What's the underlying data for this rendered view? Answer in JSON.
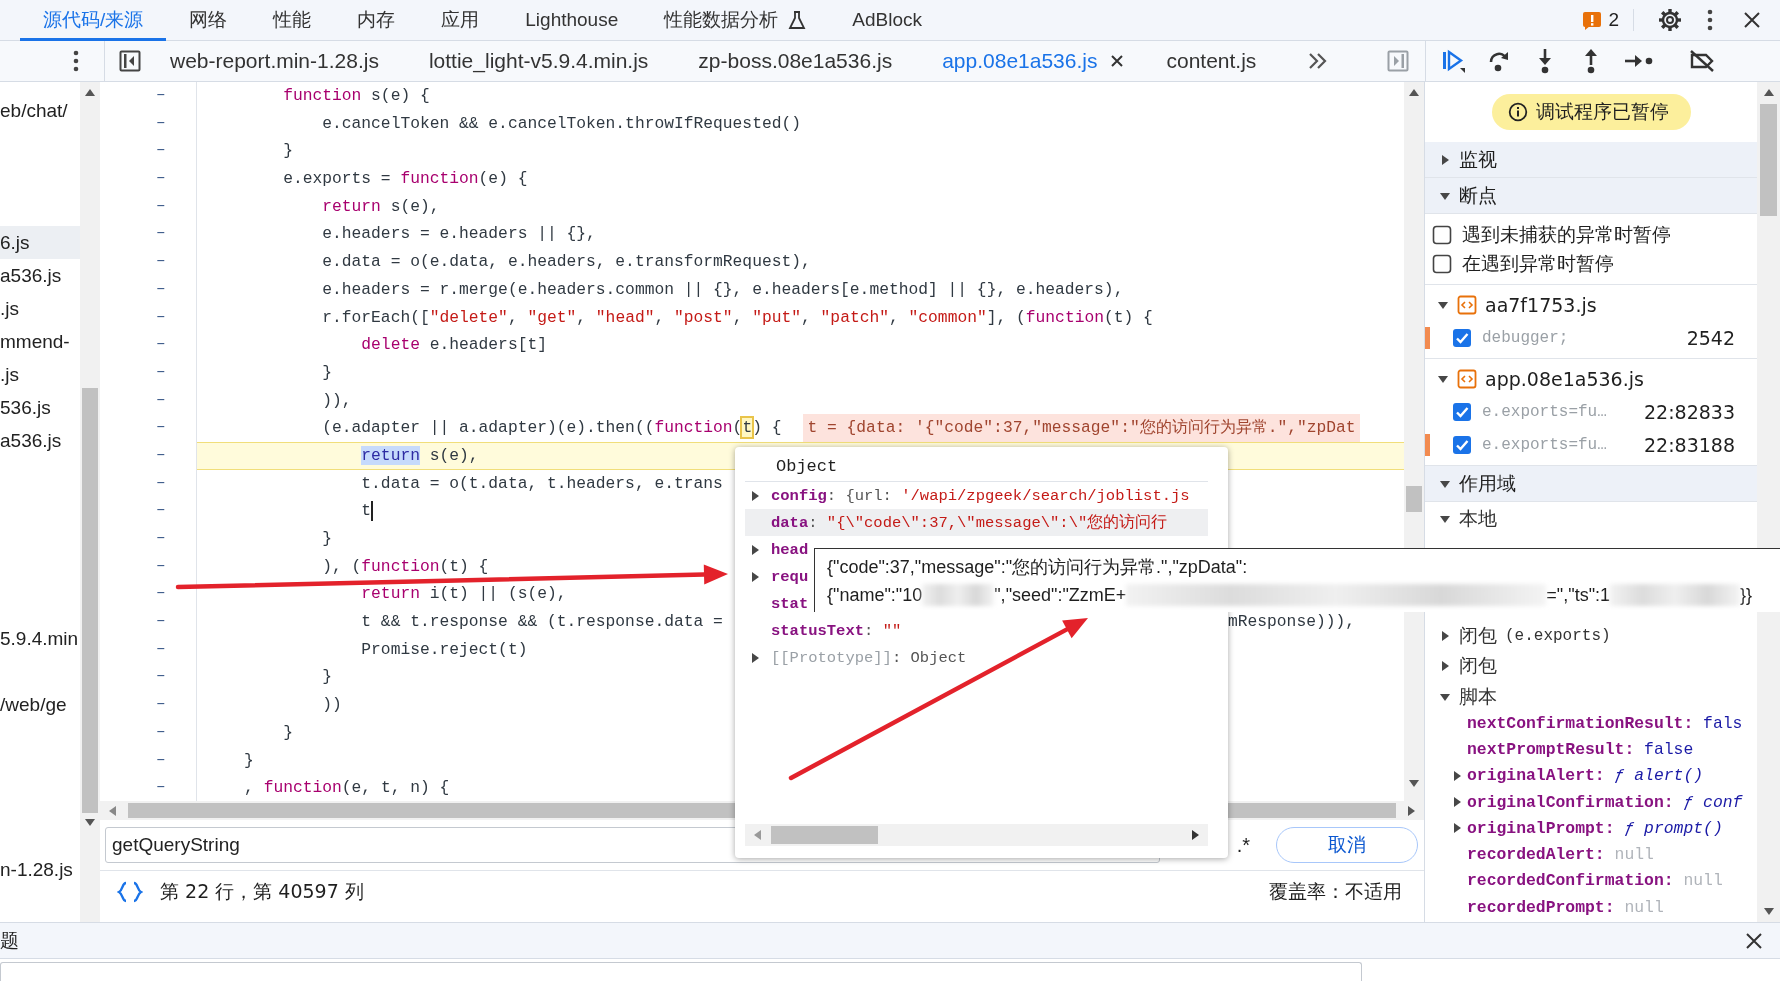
{
  "devtools_tabs": [
    {
      "label": "源代码/来源",
      "selected": true,
      "experimental": false
    },
    {
      "label": "网络",
      "selected": false,
      "experimental": false
    },
    {
      "label": "性能",
      "selected": false,
      "experimental": false
    },
    {
      "label": "内存",
      "selected": false,
      "experimental": false
    },
    {
      "label": "应用",
      "selected": false,
      "experimental": false
    },
    {
      "label": "Lighthouse",
      "selected": false,
      "experimental": false
    },
    {
      "label": "性能数据分析",
      "selected": false,
      "experimental": true
    },
    {
      "label": "AdBlock",
      "selected": false,
      "experimental": false
    }
  ],
  "issues_badge": {
    "count": "2"
  },
  "file_tabs": [
    {
      "label": "web-report.min-1.28.js",
      "selected": false
    },
    {
      "label": "lottie_light-v5.9.4.min.js",
      "selected": false
    },
    {
      "label": "zp-boss.08e1a536.js",
      "selected": false
    },
    {
      "label": "app.08e1a536.js",
      "selected": true
    },
    {
      "label": "content.js",
      "selected": false
    }
  ],
  "navigator": {
    "items": [
      {
        "label": "eb/chat/",
        "selected": false
      },
      {
        "label": "6.js",
        "selected": true
      },
      {
        "label": "a536.js",
        "selected": false
      },
      {
        "label": ".js",
        "selected": false
      },
      {
        "label": "mmend-",
        "selected": false
      },
      {
        "label": ".js",
        "selected": false
      },
      {
        "label": "536.js",
        "selected": false
      },
      {
        "label": "a536.js",
        "selected": false
      },
      {
        "label": "5.9.4.min",
        "selected": false
      },
      {
        "label": "/web/ge",
        "selected": false
      },
      {
        "label": "n-1.28.js",
        "selected": false
      }
    ]
  },
  "editor": {
    "lines": [
      {
        "mark": "–",
        "paused": false,
        "caret": false,
        "tokens": [
          {
            "kind": "keyword",
            "text": "        function"
          },
          {
            "kind": "plain",
            "text": " s(e) {"
          }
        ]
      },
      {
        "mark": "–",
        "paused": false,
        "caret": false,
        "tokens": [
          {
            "kind": "plain",
            "text": "            e.cancelToken && e.cancelToken.throwIfRequested()"
          }
        ]
      },
      {
        "mark": "–",
        "paused": false,
        "caret": false,
        "tokens": [
          {
            "kind": "plain",
            "text": "        }"
          }
        ]
      },
      {
        "mark": "–",
        "paused": false,
        "caret": false,
        "tokens": [
          {
            "kind": "plain",
            "text": "        e.exports = "
          },
          {
            "kind": "keyword",
            "text": "function"
          },
          {
            "kind": "plain",
            "text": "(e) {"
          }
        ]
      },
      {
        "mark": "–",
        "paused": false,
        "caret": false,
        "tokens": [
          {
            "kind": "keyword",
            "text": "            return"
          },
          {
            "kind": "plain",
            "text": " s(e),"
          }
        ]
      },
      {
        "mark": "–",
        "paused": false,
        "caret": false,
        "tokens": [
          {
            "kind": "plain",
            "text": "            e.headers = e.headers || {},"
          }
        ]
      },
      {
        "mark": "–",
        "paused": false,
        "caret": false,
        "tokens": [
          {
            "kind": "plain",
            "text": "            e.data = o(e.data, e.headers, e.transformRequest),"
          }
        ]
      },
      {
        "mark": "–",
        "paused": false,
        "caret": false,
        "tokens": [
          {
            "kind": "plain",
            "text": "            e.headers = r.merge(e.headers.common || {}, e.headers[e.method] || {}, e.headers),"
          }
        ]
      },
      {
        "mark": "–",
        "paused": false,
        "caret": false,
        "tokens": [
          {
            "kind": "plain",
            "text": "            r.forEach(["
          },
          {
            "kind": "string",
            "text": "\"delete\""
          },
          {
            "kind": "plain",
            "text": ", "
          },
          {
            "kind": "string",
            "text": "\"get\""
          },
          {
            "kind": "plain",
            "text": ", "
          },
          {
            "kind": "string",
            "text": "\"head\""
          },
          {
            "kind": "plain",
            "text": ", "
          },
          {
            "kind": "string",
            "text": "\"post\""
          },
          {
            "kind": "plain",
            "text": ", "
          },
          {
            "kind": "string",
            "text": "\"put\""
          },
          {
            "kind": "plain",
            "text": ", "
          },
          {
            "kind": "string",
            "text": "\"patch\""
          },
          {
            "kind": "plain",
            "text": ", "
          },
          {
            "kind": "string",
            "text": "\"common\""
          },
          {
            "kind": "plain",
            "text": "], ("
          },
          {
            "kind": "keyword",
            "text": "function"
          },
          {
            "kind": "plain",
            "text": "(t) {"
          }
        ]
      },
      {
        "mark": "–",
        "paused": false,
        "caret": false,
        "tokens": [
          {
            "kind": "keyword",
            "text": "                delete"
          },
          {
            "kind": "plain",
            "text": " e.headers[t]"
          }
        ]
      },
      {
        "mark": "–",
        "paused": false,
        "caret": false,
        "tokens": [
          {
            "kind": "plain",
            "text": "            }"
          }
        ]
      },
      {
        "mark": "–",
        "paused": false,
        "caret": false,
        "tokens": [
          {
            "kind": "plain",
            "text": "            )),"
          }
        ]
      },
      {
        "mark": "–",
        "paused": false,
        "caret": false,
        "tokens": [
          {
            "kind": "plain",
            "text": "            (e.adapter || a.adapter)(e).then(("
          },
          {
            "kind": "keyword",
            "text": "function"
          },
          {
            "kind": "plain",
            "text": "("
          },
          {
            "kind": "boxed",
            "text": "t"
          },
          {
            "kind": "plain",
            "text": ") {"
          }
        ],
        "inline_value": "t = {data: '{\"code\":37,\"message\":\"您的访问行为异常.\",\"zpDat"
      },
      {
        "mark": "–",
        "paused": true,
        "caret": false,
        "tokens": [
          {
            "kind": "match",
            "text": "                return"
          },
          {
            "kind": "plain",
            "text": " s(e),"
          }
        ]
      },
      {
        "mark": "–",
        "paused": false,
        "caret": false,
        "tokens": [
          {
            "kind": "plain",
            "text": "                t.data = o(t.data, t.headers, e.trans"
          }
        ]
      },
      {
        "mark": "–",
        "paused": false,
        "caret": true,
        "tokens": [
          {
            "kind": "plain",
            "text": "                t"
          }
        ]
      },
      {
        "mark": "–",
        "paused": false,
        "caret": false,
        "tokens": [
          {
            "kind": "plain",
            "text": "            }"
          }
        ]
      },
      {
        "mark": "–",
        "paused": false,
        "caret": false,
        "tokens": [
          {
            "kind": "plain",
            "text": "            ), ("
          },
          {
            "kind": "keyword",
            "text": "function"
          },
          {
            "kind": "plain",
            "text": "(t) {"
          }
        ]
      },
      {
        "mark": "–",
        "paused": false,
        "caret": false,
        "tokens": [
          {
            "kind": "keyword",
            "text": "                return"
          },
          {
            "kind": "plain",
            "text": " i(t) || (s(e),"
          }
        ]
      },
      {
        "mark": "–",
        "paused": false,
        "caret": false,
        "tokens": [
          {
            "kind": "plain",
            "text": "                t && t.response && (t.response.data ="
          }
        ],
        "tail": "mResponse))),"
      },
      {
        "mark": "–",
        "paused": false,
        "caret": false,
        "tokens": [
          {
            "kind": "plain",
            "text": "                Promise.reject(t)"
          }
        ]
      },
      {
        "mark": "–",
        "paused": false,
        "caret": false,
        "tokens": [
          {
            "kind": "plain",
            "text": "            }"
          }
        ]
      },
      {
        "mark": "–",
        "paused": false,
        "caret": false,
        "tokens": [
          {
            "kind": "plain",
            "text": "            ))"
          }
        ]
      },
      {
        "mark": "–",
        "paused": false,
        "caret": false,
        "tokens": [
          {
            "kind": "plain",
            "text": "        }"
          }
        ]
      },
      {
        "mark": "–",
        "paused": false,
        "caret": false,
        "tokens": [
          {
            "kind": "plain",
            "text": "    }"
          }
        ]
      },
      {
        "mark": "–",
        "paused": false,
        "caret": false,
        "tokens": [
          {
            "kind": "plain",
            "text": "    , "
          },
          {
            "kind": "keyword",
            "text": "function"
          },
          {
            "kind": "plain",
            "text": "(e, t, n) {"
          }
        ]
      }
    ],
    "search": {
      "value": "getQueryString",
      "regex": ".*",
      "cancel": "取消"
    },
    "status": {
      "position": "第 22 行，第 40597 列",
      "coverage": "覆盖率：不适用"
    }
  },
  "object_popup": {
    "title": "Object",
    "rows": [
      {
        "key": "config",
        "kind": "property",
        "expandable": true,
        "highlighted": false,
        "value": [
          {
            "kind": "plain",
            "text": ": {url: "
          },
          {
            "kind": "string",
            "text": "'/wapi/zpgeek/search/joblist.js"
          }
        ]
      },
      {
        "key": "data",
        "kind": "property",
        "expandable": false,
        "highlighted": true,
        "value": [
          {
            "kind": "plain",
            "text": ": "
          },
          {
            "kind": "string",
            "text": "\"{\\\"code\\\":37,\\\"message\\\":\\\"您的访问行"
          }
        ]
      },
      {
        "key": "head",
        "kind": "property",
        "expandable": true,
        "highlighted": false
      },
      {
        "key": "requ",
        "kind": "property",
        "expandable": true,
        "highlighted": false
      },
      {
        "key": "stat",
        "kind": "property",
        "expandable": false,
        "highlighted": false
      },
      {
        "key": "statusText",
        "kind": "property",
        "expandable": false,
        "highlighted": false,
        "value": [
          {
            "kind": "plain",
            "text": ": "
          },
          {
            "kind": "string",
            "text": "\"\""
          }
        ]
      },
      {
        "key": "[[Prototype]]",
        "kind": "internal",
        "expandable": true,
        "highlighted": false,
        "value": [
          {
            "kind": "plain",
            "text": ": Object"
          }
        ]
      }
    ]
  },
  "value_tooltip": {
    "line_1": "{\"code\":37,\"message\":\"您的访问行为异常.\",\"zpData\":",
    "line_2": [
      {
        "kind": "text",
        "text": "{\"name\":\"10"
      },
      {
        "kind": "redacted"
      },
      {
        "kind": "text",
        "text": "\",\"seed\":\"ZzmE+"
      },
      {
        "kind": "redacted"
      },
      {
        "kind": "text",
        "text": "=\",\"ts\":1"
      },
      {
        "kind": "redacted"
      },
      {
        "kind": "text",
        "text": "}}"
      }
    ]
  },
  "debugger": {
    "paused_banner": "调试程序已暂停",
    "watch": {
      "title": "监视",
      "expanded": false
    },
    "breakpoints": {
      "title": "断点",
      "expanded": true,
      "options": [
        {
          "label": "遇到未捕获的异常时暂停",
          "checked": false
        },
        {
          "label": "在遇到异常时暂停",
          "checked": false
        }
      ],
      "files": [
        {
          "name": "aa7f1753.js",
          "expanded": true,
          "items": [
            {
              "code": "debugger;",
              "location": "2542",
              "checked": true,
              "hit": true
            }
          ]
        },
        {
          "name": "app.08e1a536.js",
          "expanded": true,
          "items": [
            {
              "code": "e.exports=fu…",
              "location": "22:82833",
              "checked": true,
              "hit": false
            },
            {
              "code": "e.exports=fu…",
              "location": "22:83188",
              "checked": true,
              "hit": true
            }
          ]
        }
      ]
    },
    "scope": {
      "title": "作用域",
      "expanded": true,
      "groups": [
        {
          "label": "本地",
          "expanded": true
        },
        {
          "label": "闭包",
          "detail": "(e.exports)",
          "expanded": false
        },
        {
          "label": "闭包",
          "expanded": false
        },
        {
          "label": "脚本",
          "expanded": true,
          "children": [
            {
              "name": "nextConfirmationResult:",
              "value": "fals",
              "kind": "boolean",
              "expandable": false
            },
            {
              "name": "nextPromptResult:",
              "value": "false",
              "kind": "boolean",
              "expandable": false
            },
            {
              "name": "originalAlert:",
              "value": "ƒ alert()",
              "kind": "function",
              "expandable": true
            },
            {
              "name": "originalConfirmation:",
              "value": "ƒ conf",
              "kind": "function",
              "expandable": true
            },
            {
              "name": "originalPrompt:",
              "value": "ƒ prompt()",
              "kind": "function",
              "expandable": true
            },
            {
              "name": "recordedAlert:",
              "value": "null",
              "kind": "null",
              "expandable": false
            },
            {
              "name": "recordedConfirmation:",
              "value": "null",
              "kind": "null",
              "expandable": false
            },
            {
              "name": "recordedPrompt:",
              "value": "null",
              "kind": "null",
              "expandable": false
            }
          ]
        }
      ]
    }
  },
  "drawer": {
    "title": "题"
  },
  "annotations": [
    {
      "kind": "arrow"
    },
    {
      "kind": "arrow"
    }
  ]
}
